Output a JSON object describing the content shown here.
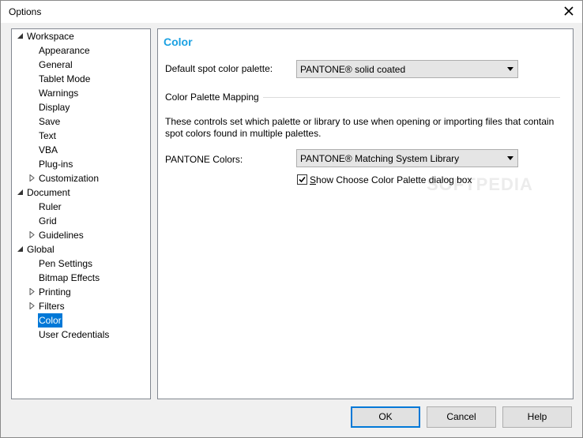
{
  "window": {
    "title": "Options"
  },
  "tree": {
    "items": [
      {
        "label": "Workspace",
        "level": 0,
        "arrow": "expanded"
      },
      {
        "label": "Appearance",
        "level": 1,
        "arrow": "none"
      },
      {
        "label": "General",
        "level": 1,
        "arrow": "none"
      },
      {
        "label": "Tablet Mode",
        "level": 1,
        "arrow": "none"
      },
      {
        "label": "Warnings",
        "level": 1,
        "arrow": "none"
      },
      {
        "label": "Display",
        "level": 1,
        "arrow": "none"
      },
      {
        "label": "Save",
        "level": 1,
        "arrow": "none"
      },
      {
        "label": "Text",
        "level": 1,
        "arrow": "none"
      },
      {
        "label": "VBA",
        "level": 1,
        "arrow": "none"
      },
      {
        "label": "Plug-ins",
        "level": 1,
        "arrow": "none"
      },
      {
        "label": "Customization",
        "level": 1,
        "arrow": "collapsed"
      },
      {
        "label": "Document",
        "level": 0,
        "arrow": "expanded"
      },
      {
        "label": "Ruler",
        "level": 1,
        "arrow": "none"
      },
      {
        "label": "Grid",
        "level": 1,
        "arrow": "none"
      },
      {
        "label": "Guidelines",
        "level": 1,
        "arrow": "collapsed"
      },
      {
        "label": "Global",
        "level": 0,
        "arrow": "expanded"
      },
      {
        "label": "Pen Settings",
        "level": 1,
        "arrow": "none"
      },
      {
        "label": "Bitmap Effects",
        "level": 1,
        "arrow": "none"
      },
      {
        "label": "Printing",
        "level": 1,
        "arrow": "collapsed"
      },
      {
        "label": "Filters",
        "level": 1,
        "arrow": "collapsed"
      },
      {
        "label": "Color",
        "level": 1,
        "arrow": "none",
        "selected": true
      },
      {
        "label": "User Credentials",
        "level": 1,
        "arrow": "none"
      }
    ]
  },
  "content": {
    "title": "Color",
    "spot_palette_label": "Default spot color palette:",
    "spot_palette_value": "PANTONE® solid coated",
    "mapping_group_label": "Color Palette Mapping",
    "mapping_description_line1": "These controls set which palette or library to use when opening or importing files that contain",
    "mapping_description_line2": "spot colors found in multiple palettes.",
    "pantone_label": "PANTONE Colors:",
    "pantone_value": "PANTONE® Matching System Library",
    "show_dialog_checked": true,
    "show_dialog_label_underlined": "S",
    "show_dialog_label_rest": "how Choose Color Palette dialog box"
  },
  "footer": {
    "ok_label": "OK",
    "cancel_label": "Cancel",
    "help_label": "Help"
  },
  "watermark": "SOFTPEDIA",
  "colors": {
    "accent": "#1ba1e2",
    "selection": "#0078d7"
  }
}
